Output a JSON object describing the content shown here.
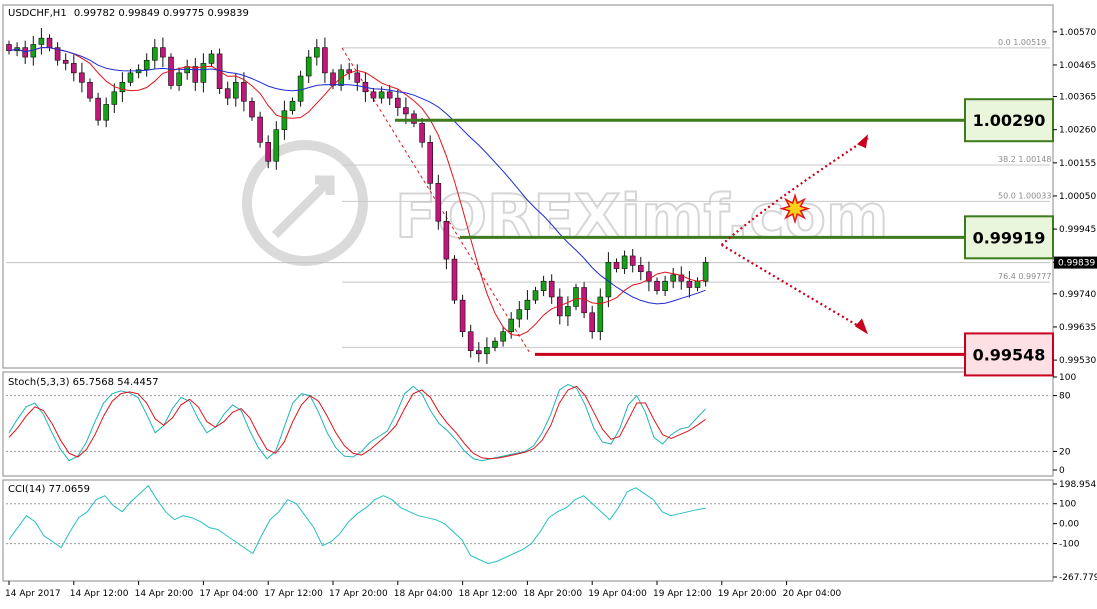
{
  "header": {
    "symbol": "USDCHF,H1",
    "ohlc": "0.99782 0.99849 0.99775 0.99839"
  },
  "watermark": "FOREXimf.com",
  "colors": {
    "bull": "#18a018",
    "bear": "#c0177a",
    "ma_fast": "#e0141a",
    "ma_slow": "#1f2bd0",
    "stoch_main": "#1fb5b5",
    "stoch_signal": "#e0141a",
    "cci": "#28c0c0",
    "green_level": "#3c7a1e",
    "red_level": "#c8001e",
    "fib": "#c8c8c8",
    "grid": "#9a9a9a"
  },
  "chart_data": [
    {
      "type": "candlestick",
      "title": "USDCHF,H1",
      "ylim": [
        0.99505,
        1.00655
      ],
      "y_ticks": [
        "1.00570",
        "1.00465",
        "1.00365",
        "1.00260",
        "1.00155",
        "1.00050",
        "0.99945",
        "0.99840",
        "0.99740",
        "0.99635",
        "0.99530"
      ],
      "y_tick_values": [
        1.0057,
        1.00465,
        1.00365,
        1.0026,
        1.00155,
        1.0005,
        0.99945,
        0.9984,
        0.9974,
        0.99635,
        0.9953
      ],
      "current_price": "0.99839",
      "x_labels": [
        "14 Apr 2017",
        "14 Apr 12:00",
        "14 Apr 20:00",
        "17 Apr 04:00",
        "17 Apr 12:00",
        "17 Apr 20:00",
        "18 Apr 04:00",
        "18 Apr 12:00",
        "18 Apr 20:00",
        "19 Apr 04:00",
        "19 Apr 12:00",
        "19 Apr 20:00",
        "20 Apr 04:00"
      ],
      "x_label_bars": [
        0,
        8,
        16,
        24,
        32,
        40,
        48,
        56,
        64,
        72,
        80,
        88,
        96
      ],
      "levels": [
        {
          "label": "1.00290",
          "value": 1.0029,
          "color": "green"
        },
        {
          "label": "0.99919",
          "value": 0.99919,
          "color": "green"
        },
        {
          "label": "0.99548",
          "value": 0.99548,
          "color": "red"
        }
      ],
      "fib_levels": [
        {
          "label": "0.0",
          "price": "1.00519",
          "value": 1.00519
        },
        {
          "label": "38.2",
          "price": "1.00148",
          "value": 1.00148
        },
        {
          "label": "50.0",
          "price": "1.00033",
          "value": 1.00033
        },
        {
          "label": "76.4",
          "price": "0.99777",
          "value": 0.99777
        }
      ],
      "close_series": [
        1.0051,
        1.0052,
        1.0049,
        1.0053,
        1.0055,
        1.0052,
        1.0048,
        1.0047,
        1.0044,
        1.0041,
        1.0036,
        1.0029,
        1.0034,
        1.0038,
        1.0041,
        1.0044,
        1.0045,
        1.0048,
        1.0052,
        1.0049,
        1.004,
        1.0044,
        1.0046,
        1.0041,
        1.0047,
        1.005,
        1.0039,
        1.0036,
        1.0041,
        1.0035,
        1.003,
        1.0022,
        1.0016,
        1.0026,
        1.0032,
        1.0035,
        1.0043,
        1.0049,
        1.0052,
        1.0044,
        1.004,
        1.0045,
        1.0044,
        1.0041,
        1.0038,
        1.0036,
        1.0038,
        1.0036,
        1.0033,
        1.0031,
        1.0028,
        1.0022,
        1.0009,
        0.9997,
        0.9985,
        0.9972,
        0.9962,
        0.9956,
        0.9955,
        0.9957,
        0.9959,
        0.9962,
        0.9966,
        0.9969,
        0.9972,
        0.9975,
        0.9978,
        0.9973,
        0.9967,
        0.997,
        0.9976,
        0.9968,
        0.9962,
        0.9973,
        0.9984,
        0.9982,
        0.9986,
        0.9983,
        0.9981,
        0.9978,
        0.9975,
        0.9978,
        0.998,
        0.9978,
        0.9976,
        0.9978,
        0.9984
      ],
      "series": [
        {
          "name": "Stoch(5,3,3)",
          "main": "65.7568",
          "signal": "54.4457",
          "ylim": [
            0,
            100
          ],
          "y_ticks": [
            "100",
            "80",
            "20",
            "0"
          ],
          "main_values": [
            40,
            55,
            68,
            72,
            60,
            40,
            22,
            10,
            15,
            30,
            52,
            72,
            82,
            85,
            83,
            78,
            60,
            40,
            48,
            66,
            78,
            74,
            55,
            40,
            46,
            60,
            70,
            64,
            42,
            24,
            12,
            20,
            46,
            72,
            82,
            80,
            62,
            40,
            24,
            15,
            14,
            20,
            30,
            36,
            42,
            60,
            82,
            90,
            82,
            64,
            50,
            42,
            32,
            20,
            12,
            10,
            12,
            14,
            16,
            18,
            20,
            26,
            40,
            60,
            86,
            92,
            88,
            70,
            45,
            30,
            28,
            44,
            70,
            80,
            62,
            35,
            28,
            38,
            44,
            46,
            56,
            65.76
          ],
          "signal_values": [
            35,
            45,
            58,
            68,
            64,
            50,
            32,
            18,
            14,
            22,
            38,
            58,
            74,
            82,
            84,
            82,
            72,
            55,
            48,
            56,
            70,
            76,
            68,
            52,
            46,
            52,
            62,
            66,
            56,
            38,
            22,
            18,
            30,
            52,
            70,
            80,
            74,
            58,
            40,
            26,
            18,
            16,
            22,
            30,
            38,
            48,
            66,
            82,
            86,
            78,
            62,
            50,
            40,
            28,
            18,
            13,
            12,
            13,
            15,
            17,
            19,
            23,
            32,
            48,
            72,
            86,
            90,
            80,
            62,
            44,
            33,
            36,
            54,
            72,
            72,
            54,
            38,
            34,
            38,
            42,
            48,
            54.45
          ]
        },
        {
          "name": "CCI(14)",
          "value": "77.0659",
          "ylim": [
            -267.7792,
            198.9541
          ],
          "y_ticks": [
            "198.9541",
            "100",
            "0.00",
            "-100",
            "-267.7792"
          ],
          "values": [
            -80,
            -20,
            40,
            10,
            -60,
            -90,
            -120,
            -40,
            30,
            60,
            120,
            140,
            90,
            60,
            110,
            150,
            190,
            120,
            60,
            20,
            40,
            30,
            10,
            -20,
            -30,
            -60,
            -90,
            -120,
            -150,
            -60,
            20,
            60,
            120,
            100,
            40,
            -20,
            -110,
            -90,
            -50,
            10,
            50,
            80,
            120,
            140,
            120,
            80,
            60,
            40,
            30,
            20,
            0,
            -40,
            -80,
            -160,
            -180,
            -200,
            -190,
            -170,
            -150,
            -130,
            -100,
            -40,
            30,
            60,
            80,
            120,
            140,
            100,
            60,
            20,
            80,
            160,
            180,
            150,
            120,
            60,
            40,
            50,
            60,
            70,
            77.07
          ]
        }
      ]
    }
  ]
}
